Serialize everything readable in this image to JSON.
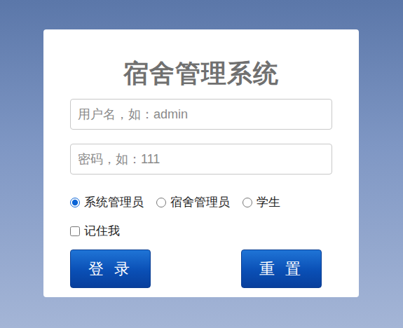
{
  "title": "宿舍管理系统",
  "fields": [
    {
      "placeholder": "用户名，如：admin",
      "kind": "text"
    },
    {
      "placeholder": "密码，如：111",
      "kind": "password"
    }
  ],
  "roles": [
    {
      "label": "系统管理员",
      "selected": true
    },
    {
      "label": "宿舍管理员",
      "selected": false
    },
    {
      "label": "学生",
      "selected": false
    }
  ],
  "remember": {
    "label": "记住我",
    "checked": false
  },
  "buttons": [
    "登 录",
    "重 置"
  ]
}
